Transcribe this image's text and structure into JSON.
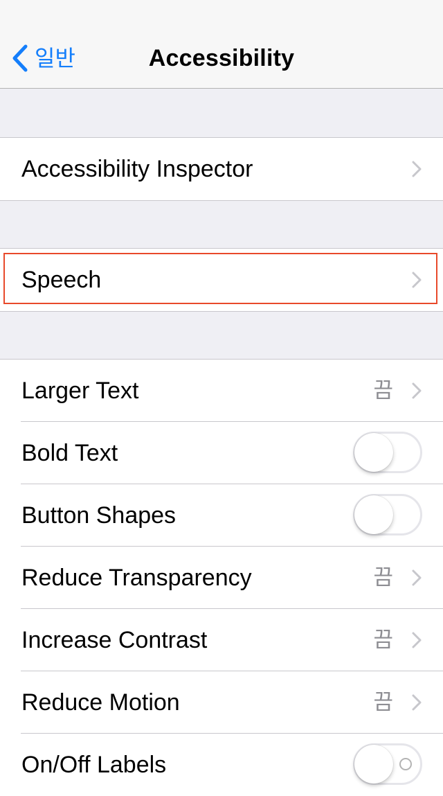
{
  "navbar": {
    "back_label": "일반",
    "title": "Accessibility"
  },
  "groups": [
    {
      "rows": [
        {
          "label": "Accessibility Inspector",
          "type": "disclosure"
        }
      ]
    },
    {
      "rows": [
        {
          "label": "Speech",
          "type": "disclosure",
          "highlighted": true
        }
      ]
    },
    {
      "rows": [
        {
          "label": "Larger Text",
          "type": "disclosure",
          "value": "끔"
        },
        {
          "label": "Bold Text",
          "type": "switch",
          "on": false
        },
        {
          "label": "Button Shapes",
          "type": "switch",
          "on": false
        },
        {
          "label": "Reduce Transparency",
          "type": "disclosure",
          "value": "끔"
        },
        {
          "label": "Increase Contrast",
          "type": "disclosure",
          "value": "끔"
        },
        {
          "label": "Reduce Motion",
          "type": "disclosure",
          "value": "끔"
        },
        {
          "label": "On/Off Labels",
          "type": "switch",
          "on": false,
          "onoff_label_visible": true
        }
      ]
    }
  ],
  "colors": {
    "accent": "#147efb",
    "background": "#efeff4",
    "separator": "#c8c7cc",
    "secondary_text": "#8e8e93",
    "highlight": "#e8492a"
  },
  "icons": {
    "back": "chevron-left-icon",
    "disclosure": "chevron-right-icon"
  }
}
